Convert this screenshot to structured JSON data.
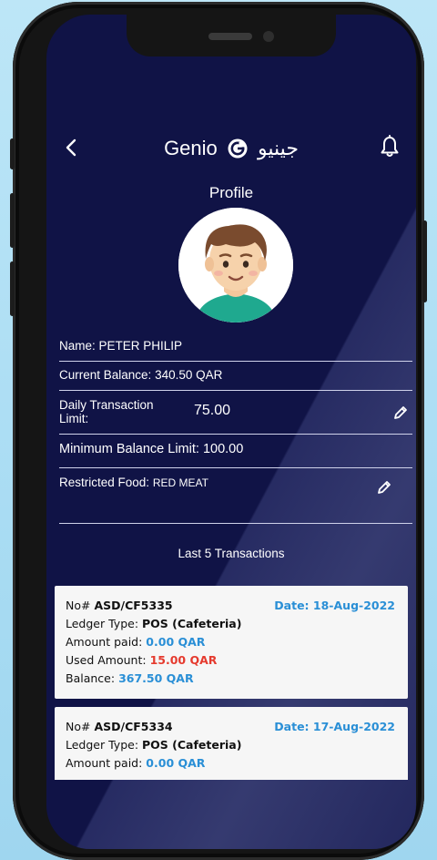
{
  "header": {
    "logo_en": "Genio",
    "logo_ar": "جينيو",
    "title": "Profile"
  },
  "profile": {
    "name_label": "Name:",
    "name": "PETER  PHILIP",
    "balance_label": "Current Balance:",
    "balance": "340.50 QAR",
    "daily_label_1": "Daily Transaction",
    "daily_label_2": "Limit:",
    "daily_value": "75.00",
    "min_label": "Minimum Balance Limit:",
    "min_value": "100.00",
    "restricted_label": "Restricted Food:",
    "restricted_value": "RED MEAT"
  },
  "transactions_title": "Last 5 Transactions",
  "transactions": [
    {
      "no_label": "No#",
      "no": "ASD/CF5335",
      "date": "Date: 18-Aug-2022",
      "type_label": "Ledger Type:",
      "type": "POS (Cafeteria)",
      "paid_label": "Amount paid:",
      "paid": "0.00 QAR",
      "used_label": "Used Amount:",
      "used": "15.00 QAR",
      "balance_label": "Balance:",
      "balance": "367.50 QAR"
    },
    {
      "no_label": "No#",
      "no": "ASD/CF5334",
      "date": "Date: 17-Aug-2022",
      "type_label": "Ledger Type:",
      "type": "POS (Cafeteria)",
      "paid_label": "Amount paid:",
      "paid": "0.00 QAR"
    }
  ],
  "colors": {
    "screen_bg": "#101346",
    "accent_blue": "#2a8fd6",
    "accent_red": "#e53a2e",
    "card_bg": "#f6f6f6"
  }
}
